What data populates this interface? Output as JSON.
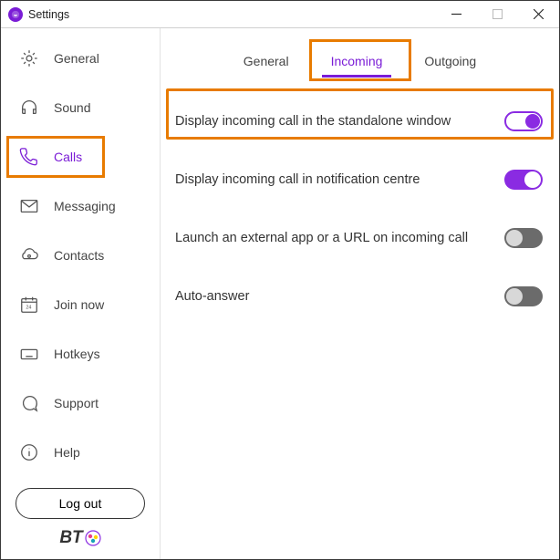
{
  "window": {
    "title": "Settings"
  },
  "sidebar": {
    "items": [
      {
        "label": "General"
      },
      {
        "label": "Sound"
      },
      {
        "label": "Calls"
      },
      {
        "label": "Messaging"
      },
      {
        "label": "Contacts"
      },
      {
        "label": "Join now"
      },
      {
        "label": "Hotkeys"
      },
      {
        "label": "Support"
      },
      {
        "label": "Help"
      }
    ],
    "logout": "Log out",
    "brand": "BT"
  },
  "tabs": {
    "items": [
      {
        "label": "General"
      },
      {
        "label": "Incoming"
      },
      {
        "label": "Outgoing"
      }
    ]
  },
  "settings": {
    "rows": [
      {
        "label": "Display incoming call in the standalone window",
        "on": true
      },
      {
        "label": "Display incoming call in notification centre",
        "on": true
      },
      {
        "label": "Launch an external app or a URL on incoming call",
        "on": false
      },
      {
        "label": "Auto-answer",
        "on": false
      }
    ]
  }
}
